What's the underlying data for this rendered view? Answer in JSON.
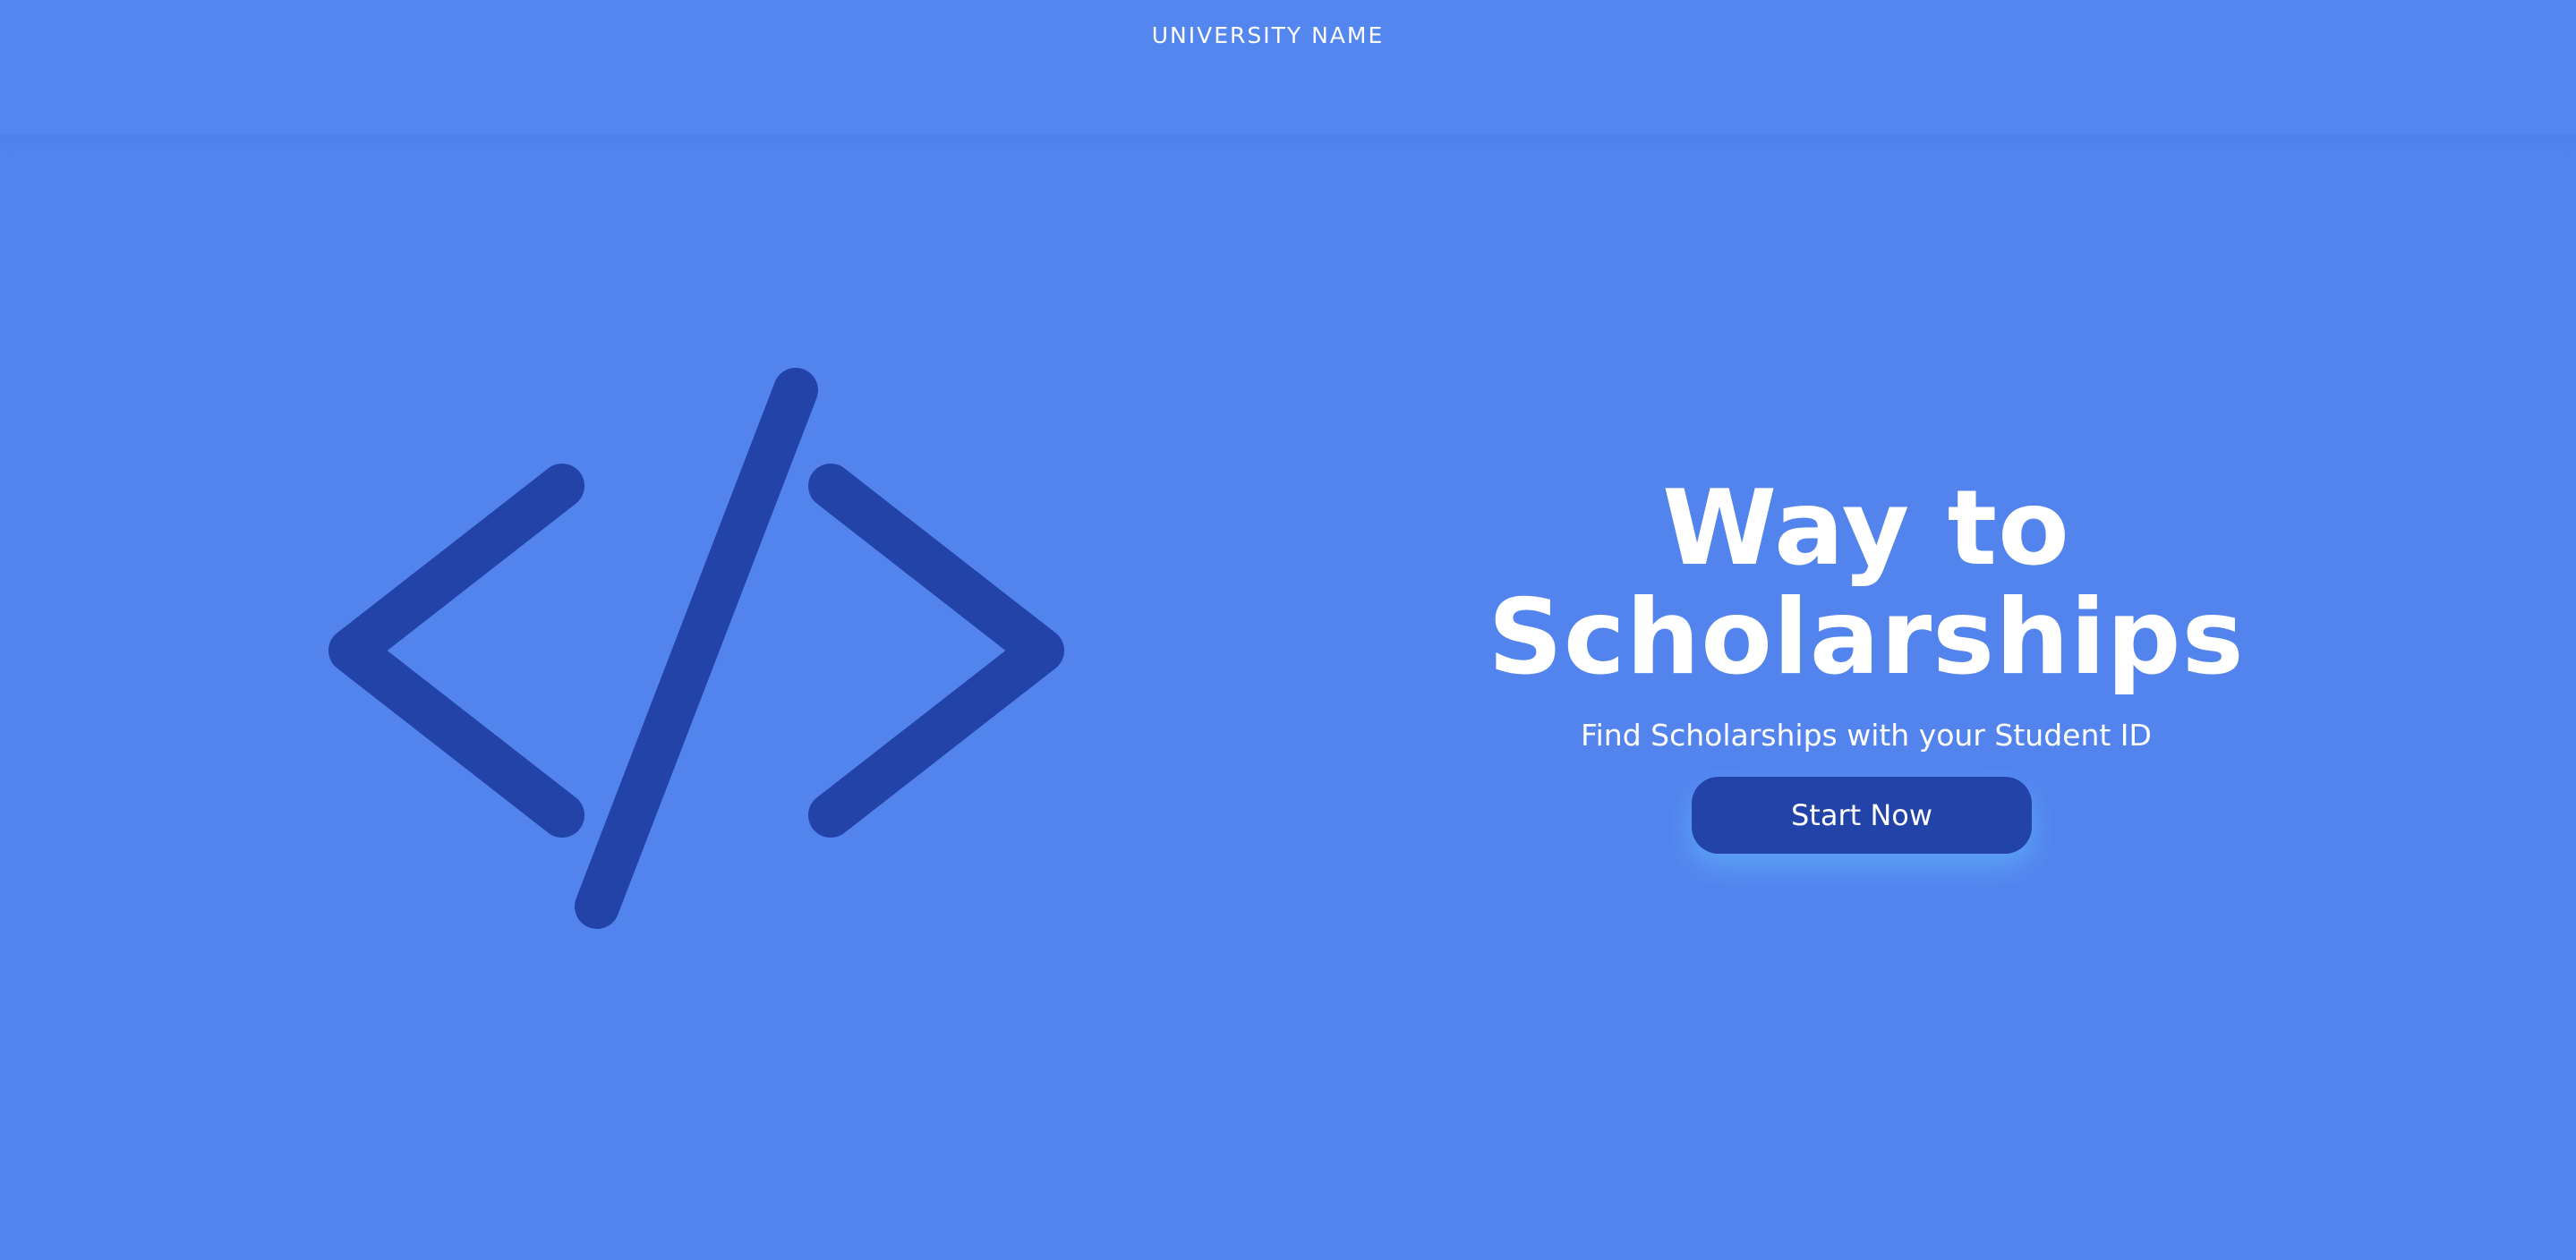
{
  "header": {
    "brand": "UNIVERSITY NAME"
  },
  "hero": {
    "title_line1": "Way to",
    "title_line2": "Scholarships",
    "subtitle": "Find Scholarships with your Student ID",
    "cta_label": "Start Now",
    "icon": "code-icon"
  },
  "colors": {
    "background": "#5384ee",
    "icon": "#2243a8",
    "button": "#2243a8",
    "text": "#ffffff"
  }
}
